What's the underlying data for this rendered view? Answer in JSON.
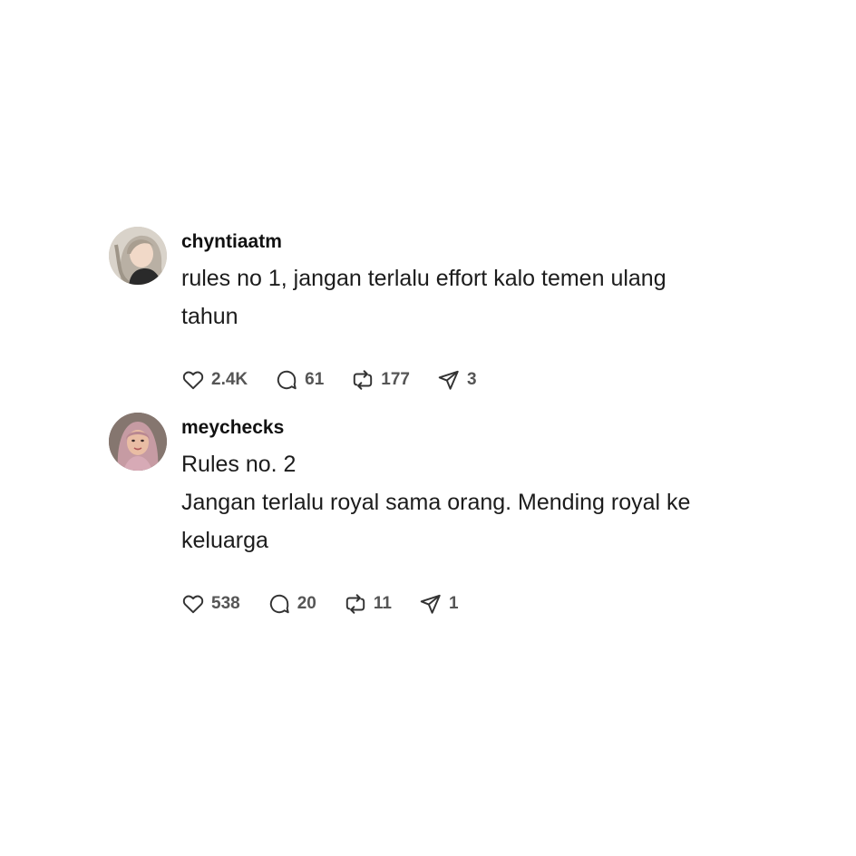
{
  "posts": [
    {
      "username": "chyntiaatm",
      "text_lines": [
        "rules no 1, jangan terlalu effort kalo temen ulang",
        "tahun"
      ],
      "likes": "2.4K",
      "replies": "61",
      "reposts": "177",
      "shares": "3"
    },
    {
      "username": "meychecks",
      "text_lines": [
        "Rules no. 2",
        "Jangan terlalu royal sama orang. Mending royal ke",
        "keluarga"
      ],
      "likes": "538",
      "replies": "20",
      "reposts": "11",
      "shares": "1"
    }
  ],
  "icons": {
    "like": "heart-icon",
    "reply": "comment-bubble-icon",
    "repost": "repost-arrows-icon",
    "share": "send-paper-plane-icon"
  },
  "colors": {
    "background": "#ffffff",
    "text": "#1c1c1c",
    "muted": "#555555"
  }
}
